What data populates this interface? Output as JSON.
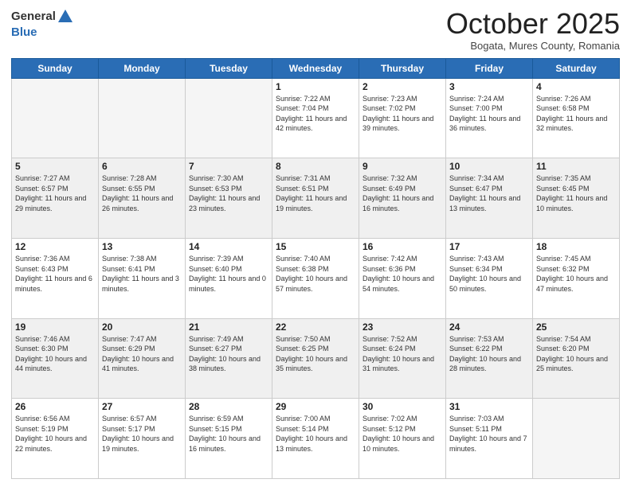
{
  "header": {
    "logo_general": "General",
    "logo_blue": "Blue",
    "month": "October 2025",
    "location": "Bogata, Mures County, Romania"
  },
  "weekdays": [
    "Sunday",
    "Monday",
    "Tuesday",
    "Wednesday",
    "Thursday",
    "Friday",
    "Saturday"
  ],
  "weeks": [
    [
      {
        "day": "",
        "empty": true
      },
      {
        "day": "",
        "empty": true
      },
      {
        "day": "",
        "empty": true
      },
      {
        "day": "1",
        "sunrise": "7:22 AM",
        "sunset": "7:04 PM",
        "daylight": "11 hours and 42 minutes."
      },
      {
        "day": "2",
        "sunrise": "7:23 AM",
        "sunset": "7:02 PM",
        "daylight": "11 hours and 39 minutes."
      },
      {
        "day": "3",
        "sunrise": "7:24 AM",
        "sunset": "7:00 PM",
        "daylight": "11 hours and 36 minutes."
      },
      {
        "day": "4",
        "sunrise": "7:26 AM",
        "sunset": "6:58 PM",
        "daylight": "11 hours and 32 minutes."
      }
    ],
    [
      {
        "day": "5",
        "sunrise": "7:27 AM",
        "sunset": "6:57 PM",
        "daylight": "11 hours and 29 minutes."
      },
      {
        "day": "6",
        "sunrise": "7:28 AM",
        "sunset": "6:55 PM",
        "daylight": "11 hours and 26 minutes."
      },
      {
        "day": "7",
        "sunrise": "7:30 AM",
        "sunset": "6:53 PM",
        "daylight": "11 hours and 23 minutes."
      },
      {
        "day": "8",
        "sunrise": "7:31 AM",
        "sunset": "6:51 PM",
        "daylight": "11 hours and 19 minutes."
      },
      {
        "day": "9",
        "sunrise": "7:32 AM",
        "sunset": "6:49 PM",
        "daylight": "11 hours and 16 minutes."
      },
      {
        "day": "10",
        "sunrise": "7:34 AM",
        "sunset": "6:47 PM",
        "daylight": "11 hours and 13 minutes."
      },
      {
        "day": "11",
        "sunrise": "7:35 AM",
        "sunset": "6:45 PM",
        "daylight": "11 hours and 10 minutes."
      }
    ],
    [
      {
        "day": "12",
        "sunrise": "7:36 AM",
        "sunset": "6:43 PM",
        "daylight": "11 hours and 6 minutes."
      },
      {
        "day": "13",
        "sunrise": "7:38 AM",
        "sunset": "6:41 PM",
        "daylight": "11 hours and 3 minutes."
      },
      {
        "day": "14",
        "sunrise": "7:39 AM",
        "sunset": "6:40 PM",
        "daylight": "11 hours and 0 minutes."
      },
      {
        "day": "15",
        "sunrise": "7:40 AM",
        "sunset": "6:38 PM",
        "daylight": "10 hours and 57 minutes."
      },
      {
        "day": "16",
        "sunrise": "7:42 AM",
        "sunset": "6:36 PM",
        "daylight": "10 hours and 54 minutes."
      },
      {
        "day": "17",
        "sunrise": "7:43 AM",
        "sunset": "6:34 PM",
        "daylight": "10 hours and 50 minutes."
      },
      {
        "day": "18",
        "sunrise": "7:45 AM",
        "sunset": "6:32 PM",
        "daylight": "10 hours and 47 minutes."
      }
    ],
    [
      {
        "day": "19",
        "sunrise": "7:46 AM",
        "sunset": "6:30 PM",
        "daylight": "10 hours and 44 minutes."
      },
      {
        "day": "20",
        "sunrise": "7:47 AM",
        "sunset": "6:29 PM",
        "daylight": "10 hours and 41 minutes."
      },
      {
        "day": "21",
        "sunrise": "7:49 AM",
        "sunset": "6:27 PM",
        "daylight": "10 hours and 38 minutes."
      },
      {
        "day": "22",
        "sunrise": "7:50 AM",
        "sunset": "6:25 PM",
        "daylight": "10 hours and 35 minutes."
      },
      {
        "day": "23",
        "sunrise": "7:52 AM",
        "sunset": "6:24 PM",
        "daylight": "10 hours and 31 minutes."
      },
      {
        "day": "24",
        "sunrise": "7:53 AM",
        "sunset": "6:22 PM",
        "daylight": "10 hours and 28 minutes."
      },
      {
        "day": "25",
        "sunrise": "7:54 AM",
        "sunset": "6:20 PM",
        "daylight": "10 hours and 25 minutes."
      }
    ],
    [
      {
        "day": "26",
        "sunrise": "6:56 AM",
        "sunset": "5:19 PM",
        "daylight": "10 hours and 22 minutes."
      },
      {
        "day": "27",
        "sunrise": "6:57 AM",
        "sunset": "5:17 PM",
        "daylight": "10 hours and 19 minutes."
      },
      {
        "day": "28",
        "sunrise": "6:59 AM",
        "sunset": "5:15 PM",
        "daylight": "10 hours and 16 minutes."
      },
      {
        "day": "29",
        "sunrise": "7:00 AM",
        "sunset": "5:14 PM",
        "daylight": "10 hours and 13 minutes."
      },
      {
        "day": "30",
        "sunrise": "7:02 AM",
        "sunset": "5:12 PM",
        "daylight": "10 hours and 10 minutes."
      },
      {
        "day": "31",
        "sunrise": "7:03 AM",
        "sunset": "5:11 PM",
        "daylight": "10 hours and 7 minutes."
      },
      {
        "day": "",
        "empty": true
      }
    ]
  ]
}
